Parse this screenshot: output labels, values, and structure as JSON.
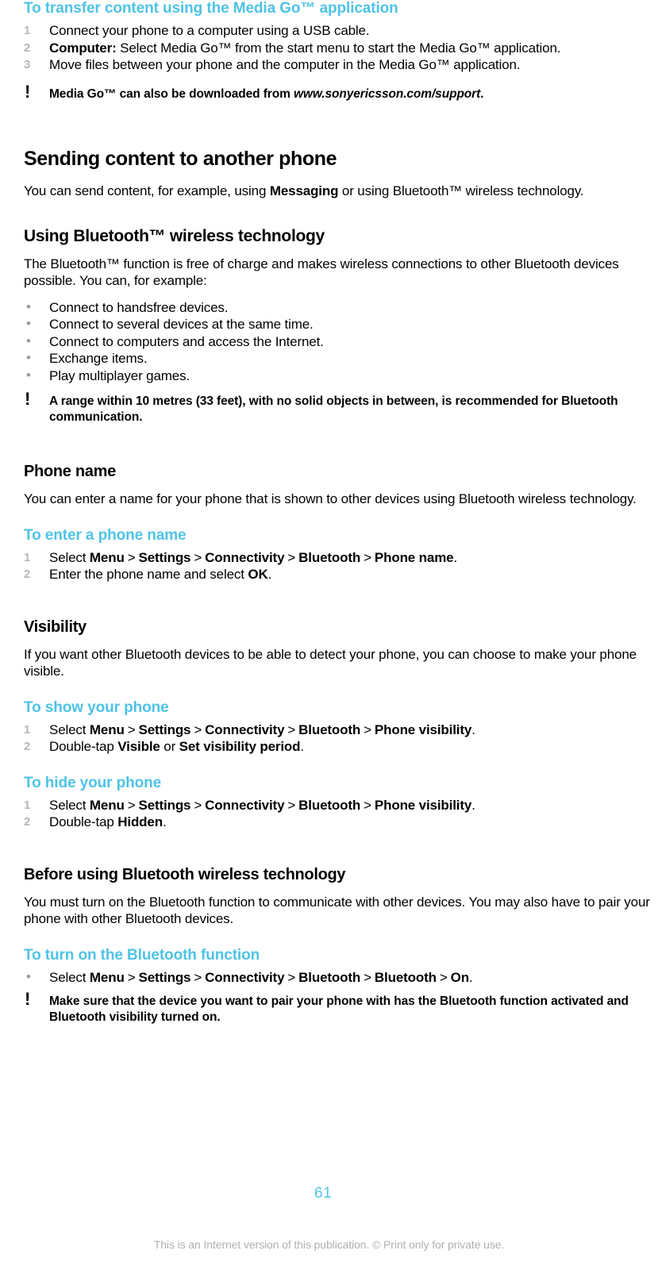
{
  "document": {
    "page_number": "61",
    "footer_note": "This is an Internet version of this publication. © Print only for private use.",
    "accent_color": "#4ec3e6",
    "marker_color": "#b6b6b6"
  },
  "sections": {
    "media_go": {
      "procedure_heading": "To transfer content using the Media Go™ application",
      "steps": [
        {
          "num": "1",
          "text": "Connect your phone to a computer using a USB cable."
        },
        {
          "num": "2",
          "bold_lead": "Computer:",
          "text": " Select Media Go™ from the start menu to start the Media Go™ application."
        },
        {
          "num": "3",
          "text": "Move files between your phone and the computer in the Media Go™ application."
        }
      ],
      "note_prefix": "Media Go™ can also be downloaded from ",
      "note_italic": "www.sonyericsson.com/support",
      "note_suffix": "."
    },
    "sending_content": {
      "heading": "Sending content to another phone",
      "paragraph_a": "You can send content, for example, using ",
      "paragraph_bold": "Messaging",
      "paragraph_b": " or using Bluetooth™ wireless technology."
    },
    "using_bluetooth": {
      "heading": "Using Bluetooth™ wireless technology",
      "paragraph": "The Bluetooth™ function is free of charge and makes wireless connections to other Bluetooth devices possible. You can, for example:",
      "bullets": [
        "Connect to handsfree devices.",
        "Connect to several devices at the same time.",
        "Connect to computers and access the Internet.",
        "Exchange items.",
        "Play multiplayer games."
      ],
      "note": "A range within 10 metres (33 feet), with no solid objects in between, is recommended for Bluetooth communication."
    },
    "phone_name": {
      "heading": "Phone name",
      "paragraph": "You can enter a name for your phone that is shown to other devices using Bluetooth wireless technology.",
      "procedure_heading": "To enter a phone name",
      "step1": {
        "num": "1",
        "lead": "Select ",
        "path": [
          "Menu",
          "Settings",
          "Connectivity",
          "Bluetooth",
          "Phone name"
        ],
        "tail": "."
      },
      "step2": {
        "num": "2",
        "lead": "Enter the phone name and select ",
        "bold": "OK",
        "tail": "."
      }
    },
    "visibility": {
      "heading": "Visibility",
      "paragraph": "If you want other Bluetooth devices to be able to detect your phone, you can choose to make your phone visible.",
      "show": {
        "procedure_heading": "To show your phone",
        "step1": {
          "num": "1",
          "lead": "Select ",
          "path": [
            "Menu",
            "Settings",
            "Connectivity",
            "Bluetooth",
            "Phone visibility"
          ],
          "tail": "."
        },
        "step2": {
          "num": "2",
          "lead": "Double-tap ",
          "bold1": "Visible",
          "mid": " or ",
          "bold2": "Set visibility period",
          "tail": "."
        }
      },
      "hide": {
        "procedure_heading": "To hide your phone",
        "step1": {
          "num": "1",
          "lead": "Select ",
          "path": [
            "Menu",
            "Settings",
            "Connectivity",
            "Bluetooth",
            "Phone visibility"
          ],
          "tail": "."
        },
        "step2": {
          "num": "2",
          "lead": "Double-tap ",
          "bold": "Hidden",
          "tail": "."
        }
      }
    },
    "before_using": {
      "heading": "Before using Bluetooth wireless technology",
      "paragraph": "You must turn on the Bluetooth function to communicate with other devices. You may also have to pair your phone with other Bluetooth devices.",
      "procedure_heading": "To turn on the Bluetooth function",
      "bullet_step": {
        "marker": "•",
        "lead": "Select ",
        "path": [
          "Menu",
          "Settings",
          "Connectivity",
          "Bluetooth",
          "Bluetooth",
          "On"
        ],
        "tail": "."
      },
      "note": "Make sure that the device you want to pair your phone with has the Bluetooth function activated and Bluetooth visibility turned on."
    }
  },
  "icons": {
    "note_bang": "!",
    "bullet": "•",
    "path_separator": ">"
  }
}
